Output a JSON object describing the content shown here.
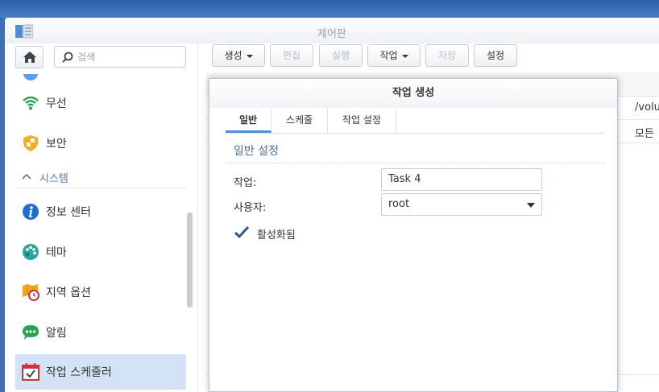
{
  "window": {
    "title": "제어판"
  },
  "sidebar": {
    "search_placeholder": "검색",
    "items": [
      {
        "label": "무선",
        "icon": "wifi-icon"
      },
      {
        "label": "보안",
        "icon": "shield-icon"
      },
      {
        "label": "정보 센터",
        "icon": "info-icon"
      },
      {
        "label": "테마",
        "icon": "palette-icon"
      },
      {
        "label": "지역 옵션",
        "icon": "map-clock-icon"
      },
      {
        "label": "알림",
        "icon": "chat-bubble-icon"
      },
      {
        "label": "작업 스케줄러",
        "icon": "calendar-check-icon",
        "active": true
      }
    ],
    "section": "시스템"
  },
  "toolbar": {
    "create": "생성",
    "edit": "편집",
    "run": "실행",
    "action": "작업",
    "save": "저장",
    "settings": "설정"
  },
  "background_table": {
    "cells": [
      "/volu",
      "모든"
    ]
  },
  "dialog": {
    "title": "작업 생성",
    "tabs": [
      "일반",
      "스케줄",
      "작업 설정"
    ],
    "section_title": "일반 설정",
    "task_label": "작업:",
    "task_value": "Task 4",
    "user_label": "사용자:",
    "user_value": "root",
    "enabled_label": "활성화됨",
    "enabled": true
  },
  "colors": {
    "accent": "#4d8edb",
    "active_item_bg": "#d3e3f5",
    "desktop": "#3a6fb5"
  }
}
